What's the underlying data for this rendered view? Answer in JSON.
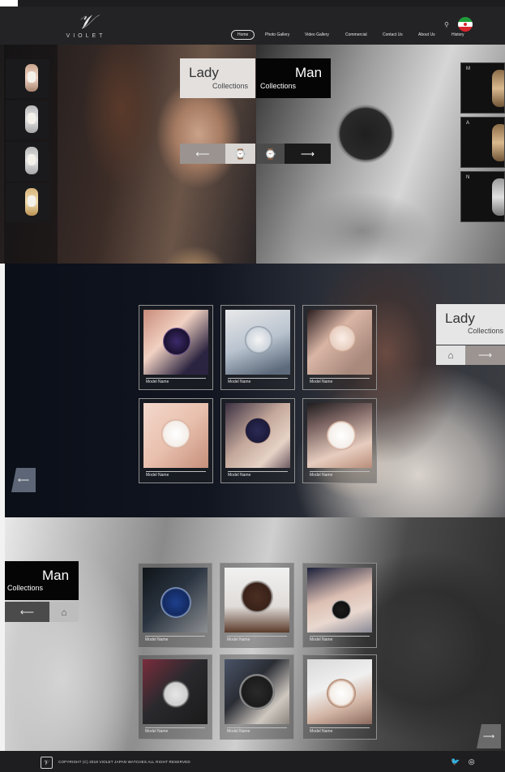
{
  "brand": {
    "mark": "𝒱",
    "name": "VIOLET"
  },
  "nav": {
    "items": [
      {
        "label": "Home",
        "active": true
      },
      {
        "label": "Photo Gallery"
      },
      {
        "label": "Video Gallery"
      },
      {
        "label": "Commercial"
      },
      {
        "label": "Contact Us"
      },
      {
        "label": "About Us"
      },
      {
        "label": "History"
      }
    ],
    "search_icon": "search-icon",
    "language_flag": "iran-flag-icon"
  },
  "hero": {
    "lady": {
      "title": "Lady",
      "subtitle": "Collections"
    },
    "man": {
      "title": "Man",
      "subtitle": "Collections"
    },
    "right_thumbs": [
      "M",
      "A",
      "N"
    ],
    "arrow_left": "⟵",
    "arrow_right": "⟶"
  },
  "lady_section": {
    "title": "Lady",
    "subtitle": "Collections",
    "cards": [
      {
        "label": "Model Name"
      },
      {
        "label": "Model Name"
      },
      {
        "label": "Model Name"
      },
      {
        "label": "Model Name"
      },
      {
        "label": "Model Name"
      },
      {
        "label": "Model Name"
      }
    ],
    "home_icon": "home-icon",
    "arrow_right": "⟶",
    "arrow_left": "⟵"
  },
  "man_section": {
    "title": "Man",
    "subtitle": "Collections",
    "cards": [
      {
        "label": "Model Name"
      },
      {
        "label": "Model Name"
      },
      {
        "label": "Model Name"
      },
      {
        "label": "Model Name"
      },
      {
        "label": "Model Name"
      },
      {
        "label": "Model Name"
      }
    ],
    "arrow_left": "⟵",
    "arrow_right": "⟶"
  },
  "footer": {
    "copyright": "COPYRIGHT (C) 2018 VIOLET JAPAN WATCHES ALL RIGHT RESERVED",
    "logo_letter": "𝒱",
    "twitter_icon": "twitter-icon",
    "instagram_icon": "instagram-icon"
  }
}
